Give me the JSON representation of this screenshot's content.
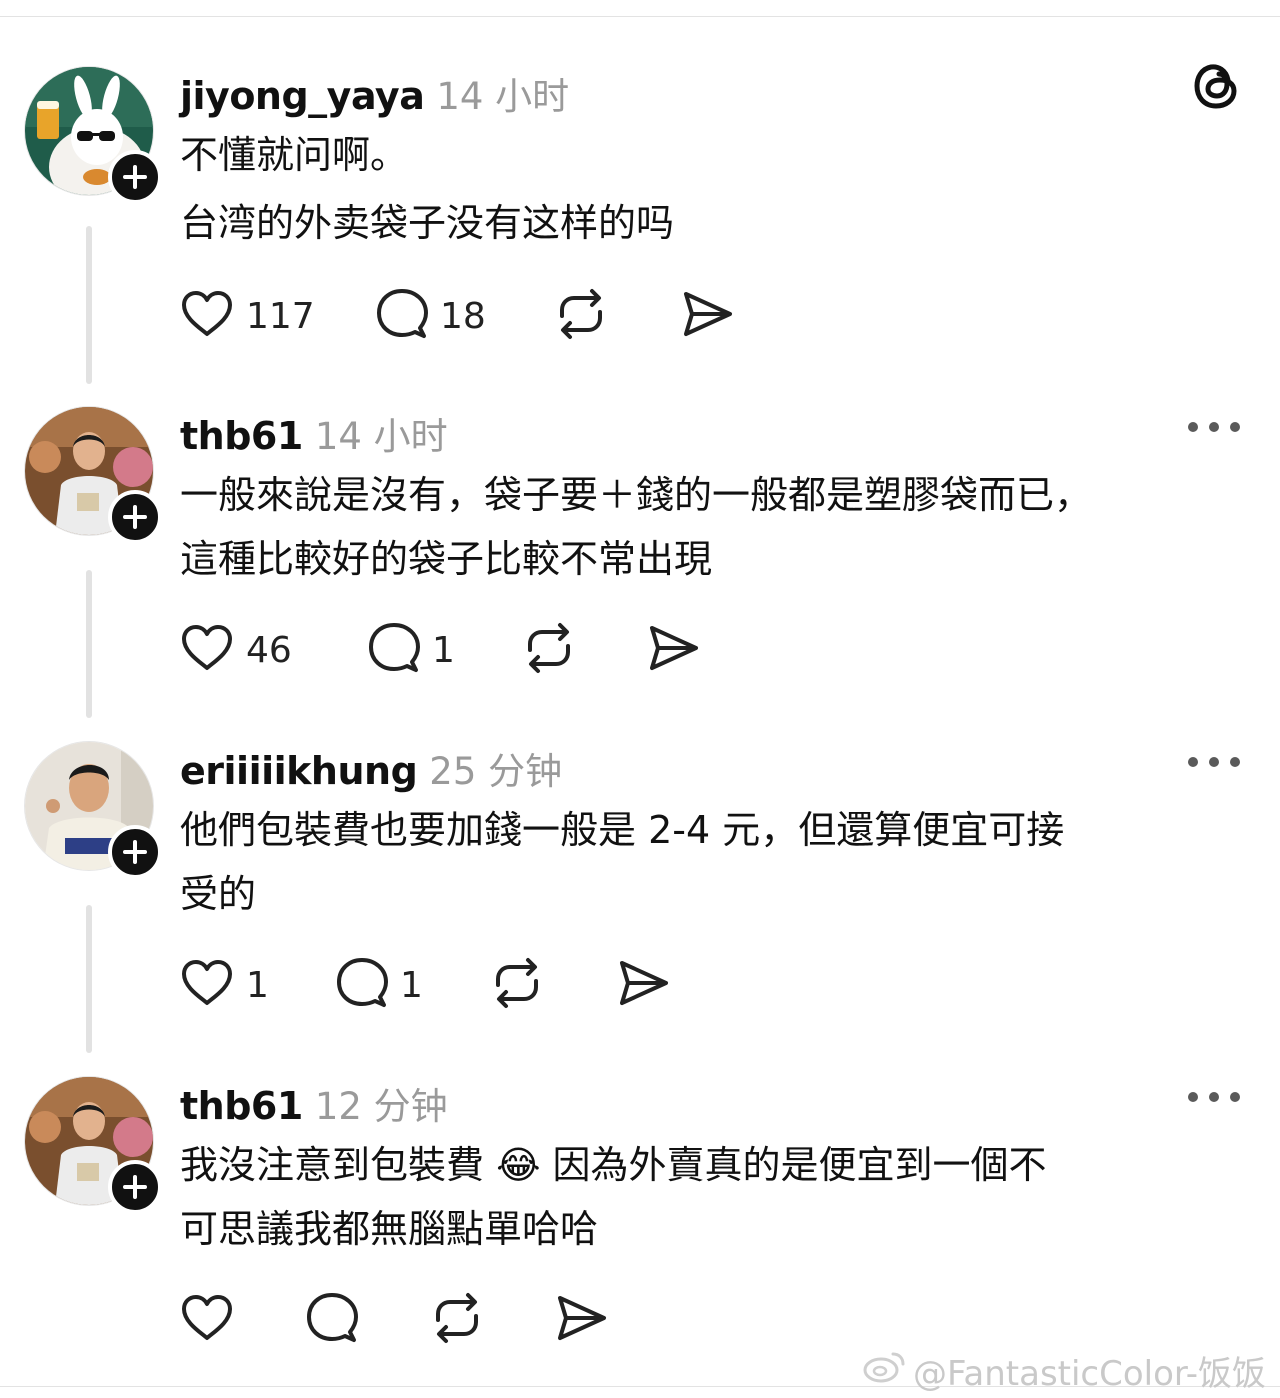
{
  "app": {
    "logo_icon": "threads-logo-icon"
  },
  "posts": [
    {
      "username": "jiyong_yaya",
      "time": "14 小时",
      "lines": [
        "不懂就问啊。",
        "台湾的外卖袋子没有这样的吗"
      ],
      "likes": "117",
      "replies": "18"
    },
    {
      "username": "thb61",
      "time": "14 小时",
      "lines": [
        "一般來說是沒有，袋子要＋錢的一般都是塑膠袋而已，",
        "這種比較好的袋子比較不常出現"
      ],
      "likes": "46",
      "replies": "1"
    },
    {
      "username": "eriiiiikhung",
      "time": "25 分钟",
      "lines": [
        "他們包裝費也要加錢一般是 2-4 元，但還算便宜可接",
        "受的"
      ],
      "likes": "1",
      "replies": "1"
    },
    {
      "username": "thb61",
      "time": "12 分钟",
      "lines": [
        "我沒注意到包裝費 😂 因為外賣真的是便宜到一個不",
        "可思議我都無腦點單哈哈"
      ],
      "likes": "",
      "replies": ""
    }
  ],
  "watermark": "@FantasticColor-饭饭",
  "icons": [
    "heart-icon",
    "comment-icon",
    "repost-icon",
    "share-icon",
    "more-icon",
    "follow-plus-icon",
    "weibo-icon"
  ]
}
